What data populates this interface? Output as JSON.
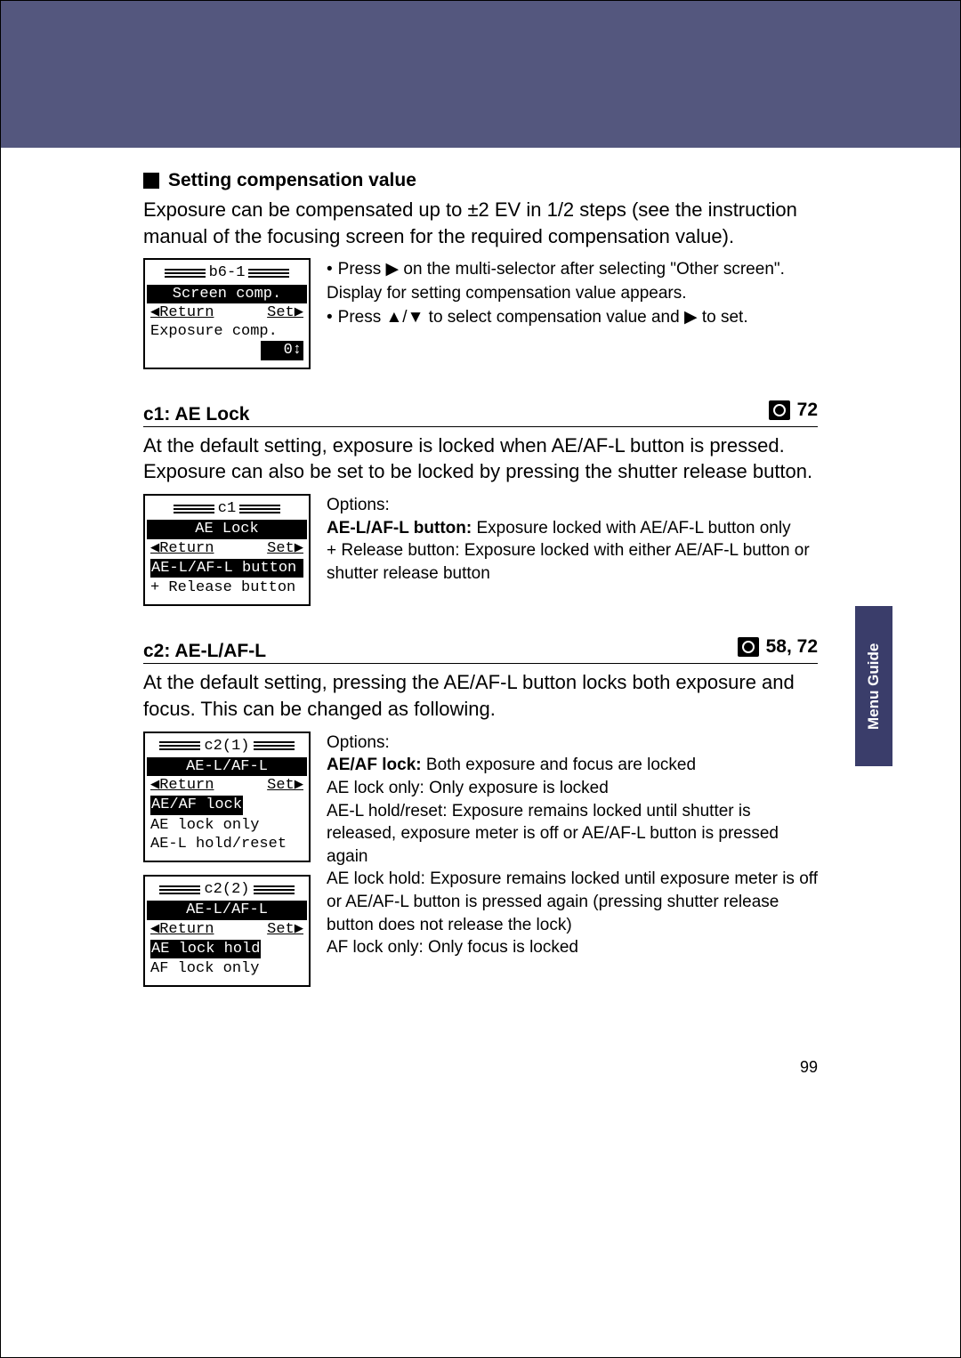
{
  "sideTab": "Menu Guide",
  "pageNumber": "99",
  "section1": {
    "title": "Setting compensation value",
    "intro": "Exposure can be compensated up to ±2 EV in 1/2 steps (see the instruction manual of the focusing screen for the required compensation value).",
    "lcd": {
      "title": "b6-1",
      "band": "Screen comp.",
      "returnL": "◀Return",
      "returnR": "Set▶",
      "row2": "Exposure comp.",
      "valueBox": "0↕"
    },
    "bullets": {
      "b1": "Press ▶ on the multi-selector after selecting \"Other screen\". Display for setting compensation value appears.",
      "b2": "Press ▲/▼ to select compensation value and ▶ to set."
    }
  },
  "section2": {
    "headerLeft": "c1: AE Lock",
    "headerRight": "72",
    "intro": "At the default setting, exposure is locked when AE/AF-L button is pressed. Exposure can also be set to be locked by pressing the shutter release button.",
    "lcd": {
      "title": "c1",
      "band": "AE Lock",
      "returnL": "◀Return",
      "returnR": "Set▶",
      "hl": "AE-L/AF-L button",
      "row3": "+ Release button"
    },
    "optionsLabel": "Options:",
    "opt1Bold": "AE-L/AF-L button:",
    "opt1Rest": " Exposure locked with AE/AF-L button only",
    "opt2": "+ Release button: Exposure locked with either AE/AF-L button or shutter release button"
  },
  "section3": {
    "headerLeft": "c2: AE-L/AF-L",
    "headerRight": "58, 72",
    "intro": "At the default setting, pressing the AE/AF-L button locks both exposure and focus. This can be changed as following.",
    "lcdA": {
      "title": "c2(1)",
      "band": "AE-L/AF-L",
      "returnL": "◀Return",
      "returnR": "Set▶",
      "hl": "AE/AF lock",
      "row3": "AE lock only",
      "row4": "AE-L hold/reset"
    },
    "lcdB": {
      "title": "c2(2)",
      "band": "AE-L/AF-L",
      "returnL": "◀Return",
      "returnR": "Set▶",
      "hl": "AE lock hold",
      "row3": "AF lock only"
    },
    "optionsLabel": "Options:",
    "opt1Bold": "AE/AF lock:",
    "opt1Rest": " Both exposure and focus are locked",
    "opt2": "AE lock only: Only exposure is locked",
    "opt3": "AE-L hold/reset: Exposure remains locked until shutter is released, exposure meter is off or AE/AF-L button is pressed again",
    "opt4": "AE lock hold: Exposure remains locked until exposure meter is off or AE/AF-L button is pressed again (pressing shutter release button does not release the lock)",
    "opt5": "AF lock only: Only focus is locked"
  }
}
